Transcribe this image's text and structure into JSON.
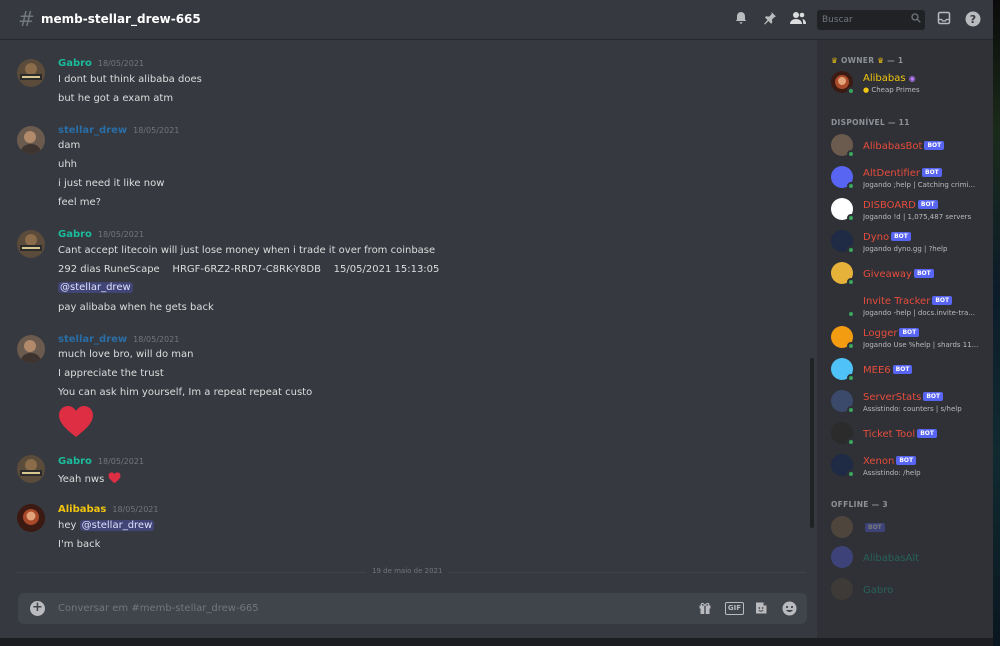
{
  "header": {
    "channel_title": "memb-stellar_drew-665",
    "search_placeholder": "Buscar"
  },
  "messages": [
    {
      "author": "Gabro",
      "color": "#1abc9c",
      "timestamp": "18/05/2021",
      "lines": [
        "I dont but think alibaba does",
        "but he got a exam atm"
      ]
    },
    {
      "author": "stellar_drew",
      "color": "#2a6ea7",
      "timestamp": "18/05/2021",
      "lines": [
        "dam",
        "uhh",
        "i just need it like now",
        "feel me?"
      ]
    },
    {
      "author": "Gabro",
      "color": "#1abc9c",
      "timestamp": "18/05/2021",
      "lines": [
        "Cant accept litecoin will just lose money when i trade it over from coinbase",
        "292 dias RuneScape    HRGF-6RZ2-RRD7-C8RK-Y8DB    15/05/2021 15:13:05",
        "@stellar_drew",
        "pay alibaba when he gets back"
      ]
    },
    {
      "author": "stellar_drew",
      "color": "#2a6ea7",
      "timestamp": "18/05/2021",
      "lines": [
        "much love bro, will do man",
        "I appreciate the trust",
        "You can ask him yourself, Im a repeat repeat custo"
      ]
    },
    {
      "author": "Gabro",
      "color": "#1abc9c",
      "timestamp": "18/05/2021",
      "lines": [
        "Yeah nws"
      ]
    },
    {
      "author": "Alibabas",
      "color": "#f1c40f",
      "timestamp": "18/05/2021",
      "lines": [
        "hey",
        "@stellar_drew",
        "I'm back"
      ]
    }
  ],
  "date_divider": "19 de maio de 2021",
  "composer": {
    "placeholder": "Conversar em #memb-stellar_drew-665"
  },
  "members": {
    "owner_header": "OWNER",
    "owner_count": "— 1",
    "owner": {
      "name": "Alibabas",
      "activity": "Cheap Primes",
      "color": "#f1c40f"
    },
    "online_header": "DISPONÍVEL — 11",
    "online": [
      {
        "name": "AlibabasBot",
        "activity": "",
        "bot": "BOT",
        "color": "#e74c3c"
      },
      {
        "name": "AltDentifier",
        "activity": "Jogando ;help | Catching crimi...",
        "bot": "BOT",
        "color": "#e74c3c"
      },
      {
        "name": "DISBOARD",
        "activity": "Jogando !d | 1,075,487 servers",
        "bot": "BOT",
        "color": "#e74c3c"
      },
      {
        "name": "Dyno",
        "activity": "Jogando dyno.gg | ?help",
        "bot": "BOT",
        "color": "#e74c3c"
      },
      {
        "name": "Giveaway",
        "activity": "",
        "bot": "BOT",
        "color": "#e74c3c"
      },
      {
        "name": "Invite Tracker",
        "activity": "Jogando -help | docs.invite-tra...",
        "bot": "BOT",
        "color": "#e74c3c"
      },
      {
        "name": "Logger",
        "activity": "Jogando Use %help | shards 11...",
        "bot": "BOT",
        "color": "#e74c3c"
      },
      {
        "name": "MEE6",
        "activity": "",
        "bot": "BOT",
        "color": "#e74c3c"
      },
      {
        "name": "ServerStats",
        "activity": "Assistindo: counters | s/help",
        "bot": "BOT",
        "color": "#e74c3c"
      },
      {
        "name": "Ticket Tool",
        "activity": "",
        "bot": "BOT",
        "color": "#e74c3c"
      },
      {
        "name": "Xenon",
        "activity": "Assistindo: /help",
        "bot": "BOT",
        "color": "#e74c3c"
      }
    ],
    "offline_header": "OFFLINE — 3",
    "offline": [
      {
        "name": "",
        "bot": "BOT",
        "color": "#e67e22"
      },
      {
        "name": "AlibabasAlt",
        "bot": "",
        "color": "#1abc9c"
      },
      {
        "name": "Gabro",
        "bot": "",
        "color": "#1abc9c"
      }
    ]
  }
}
